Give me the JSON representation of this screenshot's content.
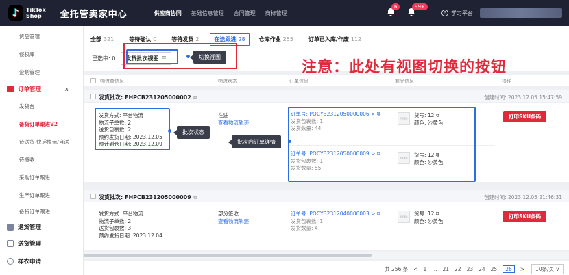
{
  "topbar": {
    "logo_line1": "TikTok",
    "logo_line2": "Shop",
    "center_title": "全托管卖家中心",
    "nav": [
      "供应商协同",
      "基础信息管理",
      "合同管理",
      "商标管理"
    ],
    "active_nav": "供应商协同",
    "notif_badge_1": "6",
    "notif_badge_2": "99+",
    "help_label": "学习平台"
  },
  "sidebar": {
    "items": [
      {
        "label": "货品管理",
        "type": "item"
      },
      {
        "label": "侵权库",
        "type": "item"
      },
      {
        "label": "企划管理",
        "type": "item"
      },
      {
        "label": "订单管理",
        "type": "header",
        "icon": "order-icon"
      },
      {
        "label": "发货台",
        "type": "item"
      },
      {
        "label": "备货订单跟进V2",
        "type": "item",
        "active": true
      },
      {
        "label": "待送货-快递快运/自送",
        "type": "item"
      },
      {
        "label": "待揽收",
        "type": "item"
      },
      {
        "label": "采购订单跟进",
        "type": "item"
      },
      {
        "label": "生产订单跟进",
        "type": "item"
      },
      {
        "label": "备货订单跟进",
        "type": "item"
      },
      {
        "label": "退货管理",
        "type": "header2",
        "icon": "return-icon"
      },
      {
        "label": "送货管理",
        "type": "header2",
        "icon": "ship-icon"
      },
      {
        "label": "样衣申请",
        "type": "header2",
        "icon": "sample-icon"
      }
    ]
  },
  "tabs": [
    {
      "label": "全部",
      "count": "321"
    },
    {
      "label": "等待确认",
      "count": "0"
    },
    {
      "label": "等待发货",
      "count": "2"
    },
    {
      "label": "在途跟进",
      "count": "28",
      "selected": true
    },
    {
      "label": "仓库作业",
      "count": "255"
    },
    {
      "label": "订单已入库/作废",
      "count": "112"
    }
  ],
  "selection": {
    "selected_label": "已选中: 0",
    "view_button": "发货批次视图",
    "view_button_icon": "☰",
    "switch_view_tag": "切换视图"
  },
  "annotation": {
    "big_note": "注意：此处有视图切换的按钮",
    "batch_status_tag": "批次状态",
    "batch_order_tag": "批次内订单详情"
  },
  "columns": [
    "物流单信息",
    "物流状态",
    "订单信息",
    "商品信息",
    "操作"
  ],
  "batches": [
    {
      "title": "发货批次: FHPCB231205000002",
      "created": "创建时间: 2023.12.05 15:47:59",
      "info": [
        "发货方式: 平台物流",
        "物流子单数: 2",
        "送货包裹数: 2",
        "预约发货日期: 2023.12.05",
        "预计到仓日期: 2023.12.09"
      ],
      "status": "在途",
      "track_link": "查看物流轨迹",
      "orders": [
        {
          "order_no": "订单号: POCYB2312050000006 >",
          "packages": "发货包裹数: 1",
          "qty": "发货数量: 44",
          "sku": "货号: 12",
          "color": "颜色: 沙黄色"
        },
        {
          "order_no": "订单号: POCYB2312050000009 >",
          "packages": "发货包裹数: 1",
          "qty": "发货数量: 55",
          "sku": "货号: 12",
          "color": "颜色: 沙黄色"
        }
      ],
      "print_button": "打印SKU条码"
    },
    {
      "title": "发货批次: FHPCB231205000009",
      "created": "创建时间: 2023.12.05 21:46:31",
      "info": [
        "发货方式: 平台物流",
        "物流子单数: 2",
        "送货包裹数: 3",
        "预约发货日期: 2023.12.04"
      ],
      "status": "部分签收",
      "track_link": "查看物流轨迹",
      "orders": [
        {
          "order_no": "订单号: POCYB2312040000003 >",
          "packages": "发货包裹数: 1",
          "qty": "发货数量: 4",
          "sku": "货号: 12",
          "color": "颜色: 沙黄色"
        }
      ],
      "print_button": "打印SKU条码"
    }
  ],
  "thumb_label": "暂无图片",
  "pager": {
    "total": "共 256 条",
    "prev": "<",
    "pages": [
      "1",
      "...",
      "21",
      "22",
      "23",
      "24",
      "25",
      "26"
    ],
    "current": "26",
    "next": ">",
    "size": "10条/页 ∨"
  },
  "colors": {
    "accent_red": "#e0293a",
    "accent_blue": "#2b6fe0",
    "topbar": "#1f2233"
  }
}
